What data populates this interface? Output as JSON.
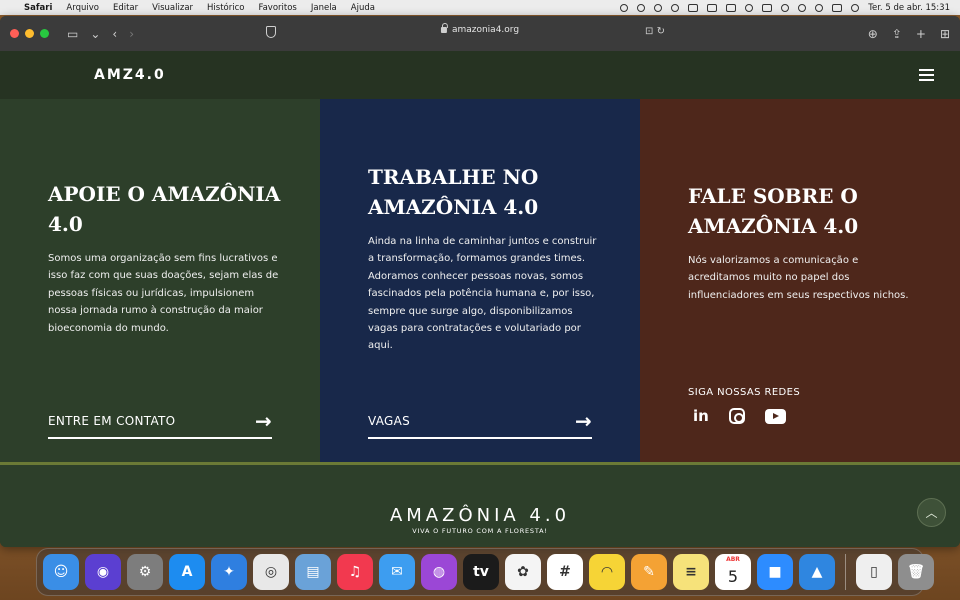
{
  "menubar": {
    "apple": "",
    "app_name": "Safari",
    "items": [
      "Arquivo",
      "Editar",
      "Visualizar",
      "Histórico",
      "Favoritos",
      "Janela",
      "Ajuda"
    ],
    "clock": "Ter. 5 de abr.  15:31"
  },
  "browser": {
    "url": "amazonia4.org",
    "back": "‹",
    "forward": "›",
    "sidebar": "▭",
    "chevron": "⌄",
    "translate": "⊡",
    "reload": "↻",
    "download": "⊕",
    "share": "⇪",
    "new_tab": "+",
    "tabs": "⊞"
  },
  "site": {
    "logo": "AMZ4.0",
    "panels": [
      {
        "title": "APOIE O AMAZÔNIA 4.0",
        "text": "Somos uma organização sem fins lucrativos e isso faz com que suas doações, sejam elas de pessoas físicas ou jurídicas, impulsionem nossa jornada rumo à construção da maior bioeconomia do mundo.",
        "link": "ENTRE EM CONTATO",
        "arrow": "→"
      },
      {
        "title": "TRABALHE NO AMAZÔNIA 4.0",
        "text": "Ainda na linha de caminhar juntos e construir a transformação, formamos grandes times. Adoramos conhecer pessoas novas, somos fascinados pela potência humana e, por isso, sempre que surge algo, disponibilizamos vagas para contratações e volutariado por aqui.",
        "link": "VAGAS",
        "arrow": "→"
      },
      {
        "title": "FALE SOBRE O AMAZÔNIA 4.0",
        "text": "Nós valorizamos a comunicação e acreditamos muito no papel dos influenciadores em seus respectivos nichos.",
        "social_label": "SIGA NOSSAS REDES",
        "linkedin": "in"
      }
    ],
    "footer": {
      "logo": "AMAZÔNIA 4.0",
      "tagline": "VIVA O FUTURO COM A FLORESTA!",
      "scroll_top": "︿"
    }
  },
  "dock": {
    "apps": [
      {
        "name": "Finder",
        "glyph": "☺",
        "color": "#3a8ee6"
      },
      {
        "name": "Siri",
        "glyph": "◉",
        "color": "#5b3fd1"
      },
      {
        "name": "System Preferences",
        "glyph": "⚙",
        "color": "#7d7d7d"
      },
      {
        "name": "App Store",
        "glyph": "A",
        "color": "#1d8cf0"
      },
      {
        "name": "Safari",
        "glyph": "✦",
        "color": "#2f7fe0"
      },
      {
        "name": "Chrome",
        "glyph": "◎",
        "color": "#e8e8e8"
      },
      {
        "name": "Preview",
        "glyph": "▤",
        "color": "#6aa2d8"
      },
      {
        "name": "Music",
        "glyph": "♫",
        "color": "#f2394f"
      },
      {
        "name": "Mail",
        "glyph": "✉",
        "color": "#3d9df0"
      },
      {
        "name": "Podcasts",
        "glyph": "◍",
        "color": "#9b47d6"
      },
      {
        "name": "TV",
        "glyph": "tv",
        "color": "#1b1b1b"
      },
      {
        "name": "Photos",
        "glyph": "✿",
        "color": "#f4f4f4"
      },
      {
        "name": "Slack",
        "glyph": "#",
        "color": "#ffffff"
      },
      {
        "name": "Miro",
        "glyph": "◠",
        "color": "#f6d436"
      },
      {
        "name": "Pages",
        "glyph": "✎",
        "color": "#f4a234"
      },
      {
        "name": "Notes",
        "glyph": "≡",
        "color": "#f6e27a"
      },
      {
        "name": "Calendar",
        "month": "ABR",
        "day": "5",
        "color": "#ffffff"
      },
      {
        "name": "Zoom",
        "glyph": "■",
        "color": "#2d8cff"
      },
      {
        "name": "Keynote",
        "glyph": "▲",
        "color": "#2f86e0"
      }
    ],
    "extras": [
      {
        "name": "Document",
        "glyph": "▯",
        "color": "#efefef"
      },
      {
        "name": "Trash",
        "glyph": "🗑",
        "color": "#8e8e8e"
      }
    ]
  }
}
